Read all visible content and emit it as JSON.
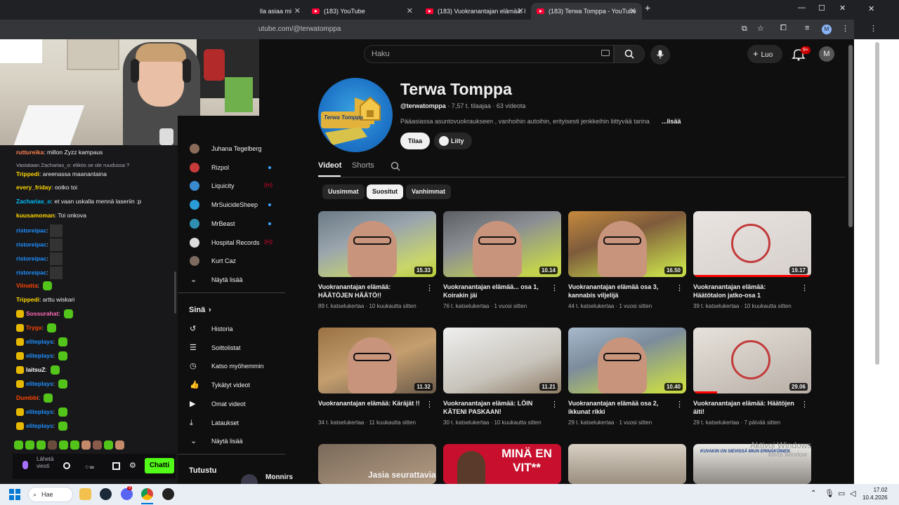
{
  "browser": {
    "tabs": [
      {
        "label": "lla asiaa mi"
      },
      {
        "label": "(183) YouTube"
      },
      {
        "label": "(183) Vuokranantajan elämää: l"
      },
      {
        "label": "(183) Terwa Tomppa - YouTube"
      }
    ],
    "new_tab": "+",
    "url": "utube.com/@terwatomppa"
  },
  "youtube": {
    "search_placeholder": "Haku",
    "create_label": "Luo",
    "notif_badge": "9+",
    "user_initial": "M",
    "channel": {
      "name": "Terwa Tomppa",
      "handle": "@terwatomppa",
      "subs": "· 7,57 t. tilaajaa",
      "videos_count": "· 63 videota",
      "description": "Pääasiassa asuntovuokraukseen , vanhoihin autoihin, erityisesti jenkkeihin liittyvää tarina",
      "more": "...lisää",
      "subscribe": "Tilaa",
      "join": "Liity",
      "logo_text": "Terwa Tomppa"
    },
    "tabs": [
      {
        "label": "Videot"
      },
      {
        "label": "Shorts"
      }
    ],
    "chips": [
      {
        "label": "Uusimmat"
      },
      {
        "label": "Suositut"
      },
      {
        "label": "Vanhimmat"
      }
    ],
    "videos": [
      {
        "title": "Vuokranantajan elämää: HÄÄTÖJEN HÄÄTÖ!!",
        "meta": "89 t. katselukertaa · 10 kuukautta sitten",
        "duration": "15.33",
        "watched": 0.0
      },
      {
        "title": "Vuokranantajan elämää... osa 1, Koirakin jäi",
        "meta": "76 t. katselukertaa · 1 vuosi sitten",
        "duration": "10.14",
        "watched": 0.0
      },
      {
        "title": "Vuokranantajan elämää osa 3, kannabis viljelijä",
        "meta": "44 t. katselukertaa · 1 vuosi sitten",
        "duration": "16.50",
        "watched": 0.0
      },
      {
        "title": "Vuokranantajan elämää: Häätötalon jatko-osa 1",
        "meta": "39 t. katselukertaa · 10 kuukautta sitten",
        "duration": "19.17",
        "watched": 1.0
      },
      {
        "title": "Vuokranantajan elämää: Käräjät !!",
        "meta": "34 t. katselukertaa · 11 kuukautta sitten",
        "duration": "11.32",
        "watched": 0.0
      },
      {
        "title": "Vuokranantajan elämää: LÖIN KÄTENI PASKAAN!",
        "meta": "30 t. katselukertaa · 10 kuukautta sitten",
        "duration": "11.21",
        "watched": 0.0
      },
      {
        "title": "Vuokranantajan elämää osa 2, ikkunat rikki",
        "meta": "29 t. katselukertaa · 1 vuosi sitten",
        "duration": "10.40",
        "watched": 0.0
      },
      {
        "title": "Vuokranantajan elämää: Häätöjen äiti!",
        "meta": "29 t. katselukertaa · 7 päivää sitten",
        "duration": "29.06",
        "watched": 0.2
      }
    ],
    "bottom_row": [
      {
        "caption": "MINÄ EN VIT**"
      },
      {
        "caption": "KUVAKIN ON SIEVISSÄ MIUN ERINÄKÖINEN"
      }
    ],
    "suggest_text": "Jasia seurattavia",
    "suggest_name": "Monnirs",
    "sidebar": {
      "subs": [
        {
          "label": "Juhana Tegelberg",
          "color": "#8a6b5a",
          "status": ""
        },
        {
          "label": "Rizpol",
          "color": "#c63a3a",
          "status": "dot"
        },
        {
          "label": "Liquicity",
          "color": "#3a8ad0",
          "status": "live"
        },
        {
          "label": "MrSuicideSheep",
          "color": "#2a9bd6",
          "status": "dot"
        },
        {
          "label": "MrBeast",
          "color": "#2f8fb0",
          "status": "dot"
        },
        {
          "label": "Hospital Records",
          "color": "#dddddd",
          "status": "live"
        },
        {
          "label": "Kurt Caz",
          "color": "#7c6b5e",
          "status": ""
        }
      ],
      "show_more": "Näytä lisää",
      "you_heading": "Sinä",
      "you_items": [
        {
          "label": "Historia",
          "icon": "history-icon"
        },
        {
          "label": "Soittolistat",
          "icon": "playlist-icon"
        },
        {
          "label": "Katso myöhemmin",
          "icon": "clock-icon"
        },
        {
          "label": "Tykätyt videot",
          "icon": "thumbs-up-icon"
        },
        {
          "label": "Omat videot",
          "icon": "video-icon"
        },
        {
          "label": "Lataukset",
          "icon": "download-icon"
        }
      ],
      "show_more2": "Näytä lisää",
      "explore_heading": "Tutustu"
    }
  },
  "chat": {
    "messages": [
      {
        "user": "ruttureika",
        "text": "millon Zyzz kampaus",
        "color": "#ff7f50"
      },
      {
        "user": "",
        "text": "Vastataan Zacharias_o: elikös se ole ruudussa ?",
        "color": "#adadb8"
      },
      {
        "user": "Trippedi",
        "text": "areenassa maanantaina",
        "color": "#ffd700"
      },
      {
        "user": "every_friday",
        "text": "ootko toi",
        "color": "#ffd700"
      },
      {
        "user": "Zacharias_o",
        "text": "et vaan uskalla mennä laseriin :p",
        "color": "#00bfff"
      },
      {
        "user": "kuusamoman",
        "text": "Toi onkova",
        "color": "#ffd700"
      },
      {
        "user": "ristoreipac",
        "text": "",
        "color": "#1e90ff"
      },
      {
        "user": "ristoreipac",
        "text": "",
        "color": "#1e90ff"
      },
      {
        "user": "ristoreipac",
        "text": "",
        "color": "#1e90ff"
      },
      {
        "user": "ristoreipac",
        "text": "",
        "color": "#1e90ff"
      },
      {
        "user": "Viinatta",
        "text": "",
        "color": "#ff4500"
      },
      {
        "user": "Trippedi",
        "text": "arttu wiskari",
        "color": "#ffd700"
      },
      {
        "user": "Sossurahat",
        "text": "",
        "color": "#ff69b4"
      },
      {
        "user": "Trygx",
        "text": "",
        "color": "#ff4500"
      },
      {
        "user": "eliteplays",
        "text": "",
        "color": "#1e90ff"
      },
      {
        "user": "eliteplays",
        "text": "",
        "color": "#1e90ff"
      },
      {
        "user": "laitsuZ",
        "text": "",
        "color": "#ffffff"
      },
      {
        "user": "eliteplays",
        "text": "",
        "color": "#1e90ff"
      },
      {
        "user": "Dumbbi",
        "text": "",
        "color": "#ff4500"
      },
      {
        "user": "eliteplays",
        "text": "",
        "color": "#1e90ff"
      },
      {
        "user": "eliteplays",
        "text": "",
        "color": "#1e90ff"
      }
    ],
    "input_placeholder": "Lähetä viesti",
    "send_label": "Chatti"
  },
  "taskbar": {
    "search_label": "Hae",
    "time": "17.02",
    "date": "10.4.2026",
    "notif_count": "9"
  },
  "watermark": {
    "line1": "Aktivoi Windows",
    "line2": "ktivoi Window"
  }
}
